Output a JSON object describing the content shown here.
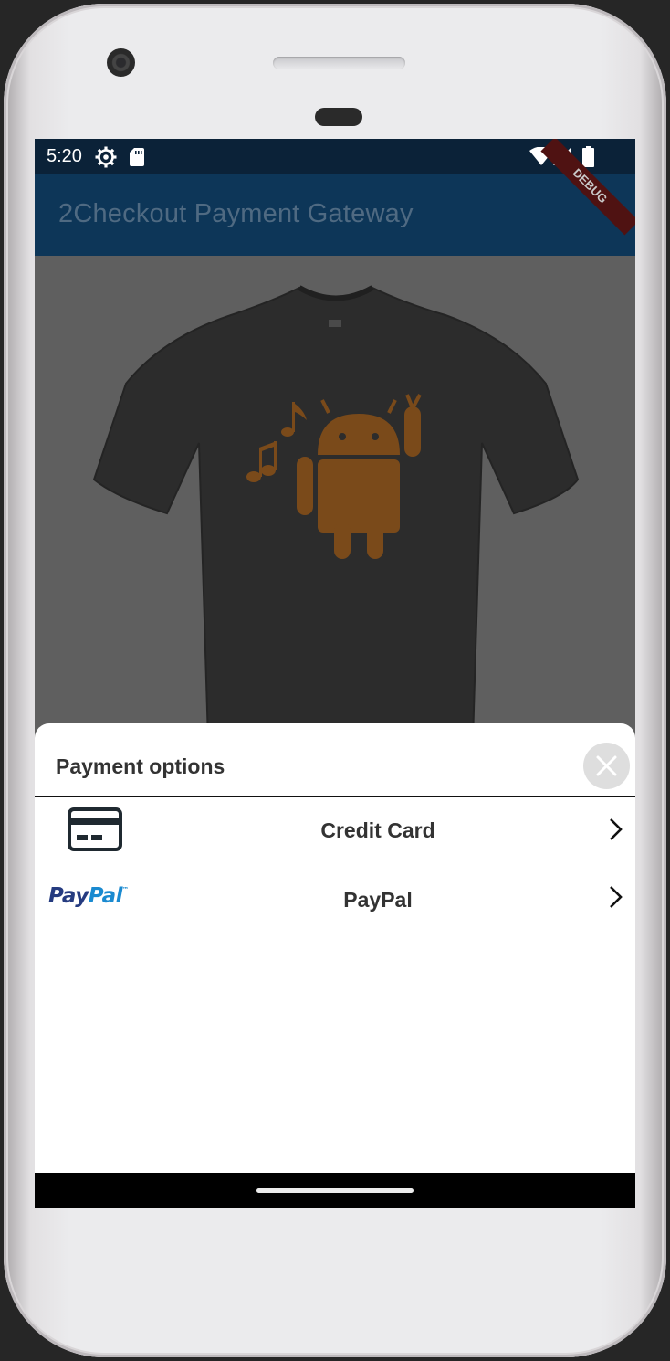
{
  "status_bar": {
    "time": "5:20",
    "icons": [
      "gear-icon",
      "sd-card-icon",
      "wifi-icon",
      "signal-icon",
      "battery-icon"
    ]
  },
  "debug_banner": "DEBUG",
  "app_bar": {
    "title": "2Checkout Payment Gateway"
  },
  "product": {
    "image": "black-tshirt-with-android-robot",
    "shirt_color": "#2b2b2b",
    "print_color": "#7a4a1a"
  },
  "payment_sheet": {
    "title": "Payment options",
    "close_icon": "close-icon",
    "options": [
      {
        "label": "Credit Card",
        "icon": "credit-card-icon",
        "chevron": "chevron-right-icon"
      },
      {
        "label": "PayPal",
        "icon": "paypal-logo",
        "chevron": "chevron-right-icon"
      }
    ]
  },
  "paypal_logo": {
    "part1": "Pay",
    "part2": "Pal",
    "tm": "™"
  },
  "colors": {
    "app_bar": "#0d3658",
    "status_bar": "#0b2238",
    "scrim": "#5f5f5f",
    "sheet": "#ffffff"
  }
}
